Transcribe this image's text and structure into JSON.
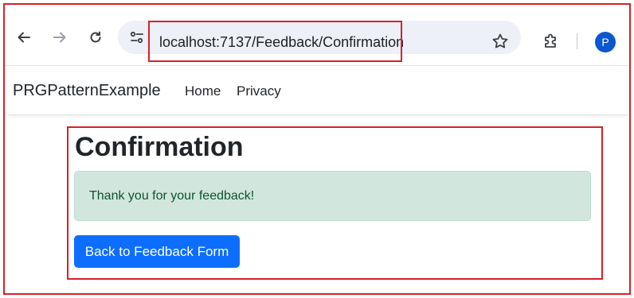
{
  "browser": {
    "url": "localhost:7137/Feedback/Confirmation",
    "profile_initial": "P",
    "icons": {
      "back": "arrow-left-icon",
      "forward": "arrow-right-icon",
      "reload": "reload-icon",
      "site_info": "tune-icon",
      "bookmark": "star-icon",
      "extensions": "puzzle-icon"
    }
  },
  "navbar": {
    "brand": "PRGPatternExample",
    "links": [
      {
        "label": "Home"
      },
      {
        "label": "Privacy"
      }
    ]
  },
  "main": {
    "title": "Confirmation",
    "alert_message": "Thank you for your feedback!",
    "back_button_label": "Back to Feedback Form"
  },
  "colors": {
    "highlight": "#d8202a",
    "alert_bg": "#d1e7dd",
    "alert_text": "#0f5132",
    "primary_button": "#0d6efd",
    "avatar": "#0b57d0"
  }
}
